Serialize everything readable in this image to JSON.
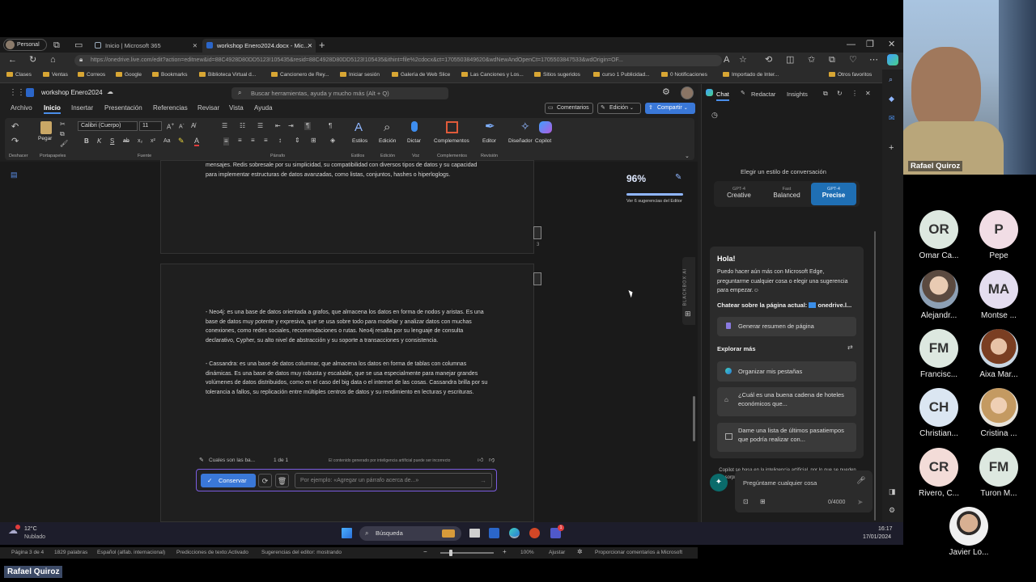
{
  "browser": {
    "profile": "Personal",
    "tabs": [
      {
        "label": "Inicio | Microsoft 365"
      },
      {
        "label": "workshop Enero2024.docx - Mic..."
      }
    ],
    "url": "https://onedrive.live.com/edit?action=editnew&id=88C4928D80DD5123!105435&resid=88C4928D80DD5123!105435&ithint=file%2cdocx&ct=1705503849620&wdNewAndOpenCt=1705503847533&wdOrigin=OF...",
    "bookmarks": [
      "Clases",
      "Ventas",
      "Correos",
      "Google",
      "Bookmarks",
      "Biblioteca Virtual d...",
      "Cancionero de Rey...",
      "Iniciar sesión",
      "Galería de Web Slice",
      "Las Canciones y Los...",
      "Sitios sugeridos",
      "curso 1 Publicidad...",
      "0 Notificaciones",
      "Importado de Inter...",
      "Otros favoritos"
    ]
  },
  "word": {
    "doc_title": "workshop Enero2024",
    "search_placeholder": "Buscar herramientas, ayuda y mucho más (Alt + Q)",
    "comments_btn": "Comentarios",
    "edit_btn": "Edición",
    "share_btn": "Compartir",
    "menu_tabs": [
      "Archivo",
      "Inicio",
      "Insertar",
      "Presentación",
      "Referencias",
      "Revisar",
      "Vista",
      "Ayuda"
    ],
    "ribbon": {
      "undo_label": "Deshacer",
      "paste_label": "Pegar",
      "clipboard_label": "Portapapeles",
      "font_name": "Calibri (Cuerpo)",
      "font_size": "11",
      "font_group": "Fuente",
      "paragraph_group": "Párrafo",
      "styles_btn": "Estilos",
      "styles_group": "Estilos",
      "editing_btn": "Edición",
      "editing_group": "Edición",
      "dictate_btn": "Dictar",
      "voice_group": "Voz",
      "addins_btn": "Complementos",
      "addins_group": "Complementos",
      "editor_btn": "Editor",
      "review_group": "Revisión",
      "designer_btn": "Diseñador",
      "copilot_btn": "Copilot"
    },
    "page1_text": "mensajes. Redis sobresale por su simplicidad, su compatibilidad con diversos tipos de datos y su capacidad para implementar estructuras de datos avanzadas, como listas, conjuntos, hashes o hiperloglogs.",
    "page_number": "3",
    "page2_para1": "- Neo4j: es una base de datos orientada a grafos, que almacena los datos en forma de nodos y aristas. Es una base de datos muy potente y expresiva, que se usa sobre todo para modelar y analizar datos con muchas conexiones, como redes sociales, recomendaciones o rutas. Neo4j resalta por su lenguaje de consulta declarativo, Cypher, su alto nivel de abstracción y su soporte a transacciones y consistencia.",
    "page2_para2": "- Cassandra: es una base de datos columnar, que almacena los datos en forma de tablas con columnas dinámicas. Es una base de datos muy robusta y escalable, que se usa especialmente para manejar grandes volúmenes de datos distribuidos, como en el caso del big data o el internet de las cosas. Cassandra brilla por su tolerancia a fallos, su replicación entre múltiples centros de datos y su rendimiento en lecturas y escrituras.",
    "editor_score": "96%",
    "editor_suggestions": "Ver 6 sugerencias del Editor",
    "blackbox_label": "BLACKBOX AI",
    "copilot_bar": {
      "prompt": "Cuales son las ba...",
      "count": "1 de 1",
      "disclaimer": "El contenido generado por inteligencia artificial puede ser incorrecto",
      "keep_btn": "Conservar",
      "input_placeholder": "Por ejemplo: «Agregar un párrafo acerca de...»"
    },
    "status": {
      "page": "Página 3 de 4",
      "words": "1829 palabras",
      "lang": "Español (alfab. internacional)",
      "predictions": "Predicciones de texto:Activado",
      "editor": "Sugerencias del editor: mostrando",
      "zoom": "100%",
      "fit": "Ajustar",
      "feedback": "Proporcionar comentarios a Microsoft"
    }
  },
  "copilot": {
    "tabs": [
      "Chat",
      "Redactar",
      "Insights"
    ],
    "style_title": "Elegir un estilo de conversación",
    "styles": [
      {
        "top": "GPT-4",
        "name": "Creative"
      },
      {
        "top": "Fast",
        "name": "Balanced"
      },
      {
        "top": "GPT-4",
        "name": "Precise"
      }
    ],
    "greeting": "Hola!",
    "intro": "Puedo hacer aún más con Microsoft Edge, preguntarme cualquier cosa o elegir una sugerencia para empezar.",
    "chat_page_label": "Chatear sobre la página actual:",
    "chat_page_site": "onedrive.l...",
    "summary_btn": "Generar resumen de página",
    "explore": "Explorar más",
    "suggestions": [
      "Organizar mis pestañas",
      "¿Cuál es una buena cadena de hoteles económicos que...",
      "Dame una lista de últimos pasatiempos que podría realizar con..."
    ],
    "disclaimer": "Copilot se basa en la inteligencia artificial, por lo que se pueden dar sorpresas y errores. Términos de uso | Directiva de privacidad",
    "ask_placeholder": "Pregúntame cualquier cosa",
    "char_count": "0/4000"
  },
  "taskbar": {
    "temp": "12°C",
    "weather": "Nublado",
    "search": "Búsqueda",
    "time": "16:17",
    "date": "17/01/2024",
    "badge": "1"
  },
  "meeting": {
    "presenter": "Rafael Quiroz",
    "bottom_label": "Rafael Quiroz",
    "participants": [
      {
        "initials": "OR",
        "name": "Omar Ca...",
        "color": "#dde8e0"
      },
      {
        "initials": "P",
        "name": "Pepe",
        "color": "#f1dde5"
      },
      {
        "initials": "",
        "name": "Alejandr...",
        "color": "#9aa6b4"
      },
      {
        "initials": "MA",
        "name": "Montse ...",
        "color": "#e4ddef"
      },
      {
        "initials": "FM",
        "name": "Francisc...",
        "color": "#dde8e0"
      },
      {
        "initials": "",
        "name": "Aixa Mar...",
        "color": "#a06c4a"
      },
      {
        "initials": "CH",
        "name": "Christian...",
        "color": "#dbe6f2"
      },
      {
        "initials": "",
        "name": "Cristina ...",
        "color": "#c8a888"
      },
      {
        "initials": "CR",
        "name": "Rivero, C...",
        "color": "#f3dcd8"
      },
      {
        "initials": "FM",
        "name": "Turon M...",
        "color": "#dde8e0"
      },
      {
        "initials": "",
        "name": "Javier Lo...",
        "color": "#b9b2aa"
      }
    ]
  }
}
